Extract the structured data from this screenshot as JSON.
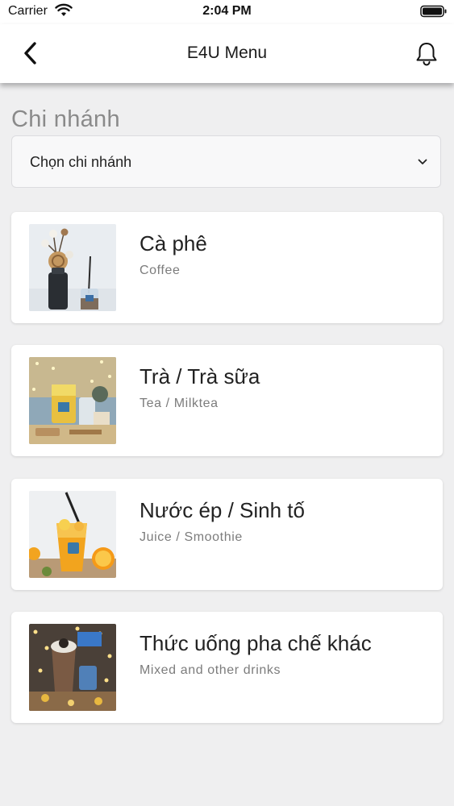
{
  "status_bar": {
    "carrier": "Carrier",
    "time": "2:04 PM"
  },
  "nav": {
    "title": "E4U Menu",
    "back_icon": "chevron-left-icon",
    "bell_icon": "bell-icon"
  },
  "branch": {
    "heading": "Chi nhánh",
    "select_value": "Chọn chi nhánh"
  },
  "categories": [
    {
      "title": "Cà phê",
      "subtitle": "Coffee"
    },
    {
      "title": "Trà / Trà sữa",
      "subtitle": "Tea / Milktea"
    },
    {
      "title": "Nước ép / Sinh tố",
      "subtitle": "Juice / Smoothie"
    },
    {
      "title": "Thức uống pha chế khác",
      "subtitle": "Mixed and other drinks"
    }
  ],
  "colors": {
    "background": "#efeff0",
    "card": "#ffffff",
    "heading": "#8a8a8a",
    "subtitle": "#7c7c7c"
  }
}
